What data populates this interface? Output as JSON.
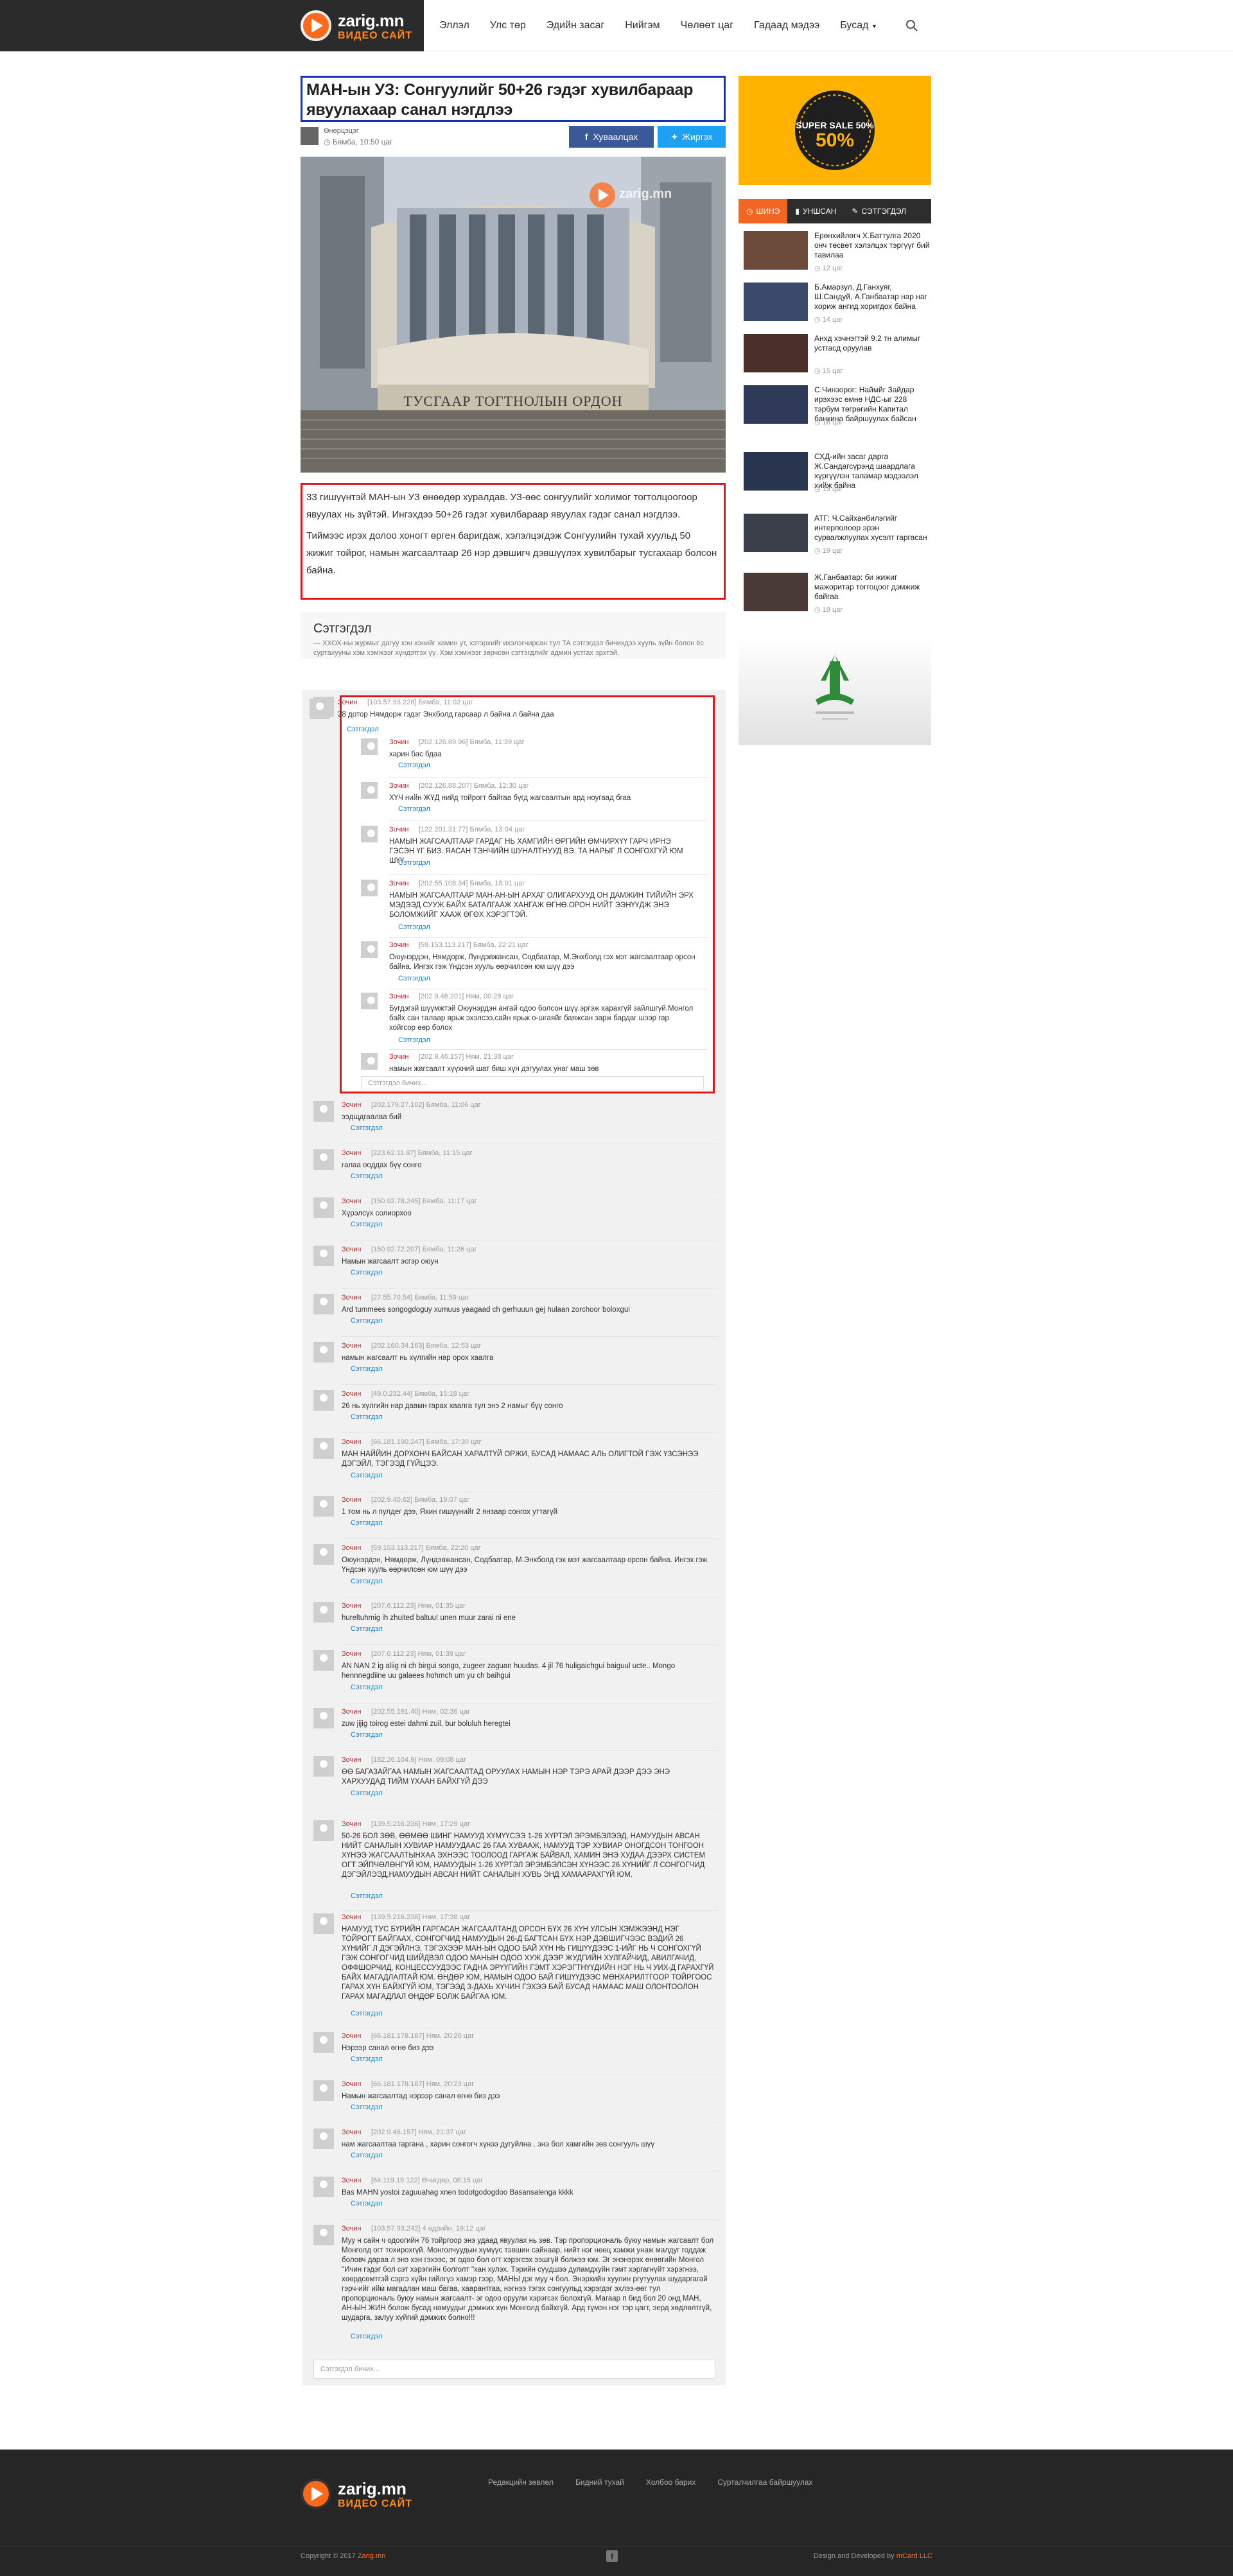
{
  "site": {
    "name": "zarig.mn",
    "tagline": "ВИДЕО САЙТ"
  },
  "nav": [
    "Эллэл",
    "Улс төр",
    "Эдийн засаг",
    "Нийгэм",
    "Чөлөөт цаг",
    "Гадаад мэдээ",
    "Бусад"
  ],
  "article": {
    "title": "МАН-ын УЗ: Сонгуулийг 50+26 гэдэг хувилбараар явуулахаар санал нэгдлээ",
    "author": "Өнөрцэцэг",
    "time": "Бямба, 10:50 цаг",
    "share_fb": "Хуваалцах",
    "share_tw": "Жиргэх",
    "image_caption": "ТУСГААР ТОГТНОЛЫН ОРДОН",
    "watermark": "zarig.mn",
    "p1": "33 гишүүнтэй МАН-ын УЗ өнөөдөр хуралдав. УЗ-өөс сонгуулийг холимог тогтолцоогоор явуулах нь зүйтэй. Ингэхдээ 50+26 гэдэг хувилбараар явуулах гэдэг санал нэгдлээ.",
    "p2": "Тиймээс ирэх долоо хоногт өрген баригдаж, хэлэлцэгдэж Сонгуулийн тухай хуульд 50 жижиг тойрог, намын жагсаалтаар 26 нэр дэвшигч дэвшүүлэх хувилбарыг тусгахаар болсон байна."
  },
  "comments_section": {
    "title": "Сэтгэгдэл",
    "note": "— ХХОХ-ны журмыг дагуу хэн хэнийг хамин ут, хэтэрхийг ихэлэгчирсан тул ТА сэтгэгдэл бичихдээ хууль зүйн болон ёс суртахууны хэм хэмжээг хүндэтгэх үү. Хэм хэмжээг зөрчсөн сэтгэгдлийг админ устгах эрхтэй.",
    "reply_label": "Сэтгэгдэл",
    "input_placeholder": "Сэтгэгдэл бичих..."
  },
  "thread": {
    "parent": {
      "name": "Зочин",
      "meta": "[103.57.93.228]  Бямба, 11:02 цаг",
      "text": "28 дотор Нямдорж гэдэг Энхболд гарсаар л байна л байна даа"
    },
    "replies": [
      {
        "name": "Зочин",
        "meta": "[202.126.89.96]  Бямба, 11:39 цаг",
        "text": "харин бас бдаа"
      },
      {
        "name": "Зочин",
        "meta": "[202.126.88.207]  Бямба, 12:30 цаг",
        "text": "ХҮЧ нийн ЖҮД нийд тойрогт байгаа бүгд жагсаалтын ард ноугаад бгаа"
      },
      {
        "name": "Зочин",
        "meta": "[122.201.31.77]  Бямба, 13:04 цаг",
        "text": "НАМЫН ЖАГСААЛТААР ГАРДАГ НЬ ХАМГИЙН ӨРГИЙН ӨМЧИРХҮҮ ГАРЧ ИРНЭ ГЭСЭН ҮГ БИЗ. ЯАСАН ТЭНЧИЙН ШУНАЛТНУУД ВЭ. ТА НАРЫГ Л СОНГОХГҮЙ ЮМ ШҮҮ"
      },
      {
        "name": "Зочин",
        "meta": "[202.55.108.34]  Бямба, 18:01 цаг",
        "text": "НАМЫН ЖАГСААЛТААР МАН-АН-ЫН АРХАГ ОЛИГАРХУУД ОН ДАМЖИН ТИЙИЙН ЭРХ МЭДЭЭД СУУЖ БАЙХ БАТАЛГААЖ ХАНГАЖ ӨГНӨ.ОРОН НИЙТ ЭЭНҮҮДЖ ЭНЭ БОЛОМЖИЙГ ХААЖ ӨГӨХ ХЭРЭГТЭЙ."
      },
      {
        "name": "Зочин",
        "meta": "[59.153.113.217]  Бямба, 22:21 цаг",
        "text": "Оюунэрдэн, Нямдорж, Лүндэвжансан, Содбаатар, М.Энхболд гэх мэт жагсаалтаар орсон байна. Ингэх гэж Үндсэн хууль өөрчилсөн юм шүү дээ"
      },
      {
        "name": "Зочин",
        "meta": "[202.9.46.201]  Ням, 00:28 цаг",
        "text": "Бүгдэгэй шүүмжтэй Оюунэрдэн ангай одоо болсон шүү.эргэж харахгүй зайлшгүй.Монгол байх сан талаар ярьж эхэлсээ,сайн ярьж о-шгаяйг баяжсан зарж бардаг шээр гар хойгсор өөр болох"
      },
      {
        "name": "Зочин",
        "meta": "[202.9.46.157]  Ням, 21:38 цаг",
        "text": "намын жагсаалт хүүхний шат биш хүн дэгуулах унаг маш зөв"
      }
    ]
  },
  "comments": [
    {
      "name": "Зочин",
      "meta": "[202.179.27.102]  Бямба, 11:06 цаг",
      "text": "ээдщдгаалаа бий"
    },
    {
      "name": "Зочин",
      "meta": "[223.62.11.87]  Бямба, 11:15 цаг",
      "text": "галаа ооддах бүү сонго"
    },
    {
      "name": "Зочин",
      "meta": "[150.92.78.245]  Бямба, 11:17 цаг",
      "text": "Хүрэлсүх солиорхоо"
    },
    {
      "name": "Зочин",
      "meta": "[150.92.72.207]  Бямба, 11:26 цаг",
      "text": "Намын жагсаалт эсгэр оюун"
    },
    {
      "name": "Зочин",
      "meta": "[27.55.70.54]  Бямба, 11:59 цаг",
      "text": "Ard tummees songogdoguy xumuus yaagaad ch gerhuuun gej hulaan zorchoor boloxgui"
    },
    {
      "name": "Зочин",
      "meta": "[202.160.34.163]  Бямба, 12:53 цаг",
      "text": "намын жагсаалт нь хүлгийн нар орох хаалга"
    },
    {
      "name": "Зочин",
      "meta": "[49.0.232.44]  Бямба, 15:18 цаг",
      "text": "26 нь хүлгийн нар даамн гарах хаалга тул энэ 2 намыг бүү сонго"
    },
    {
      "name": "Зочин",
      "meta": "[66.181.190.247]  Бямба, 17:30 цаг",
      "text": "МАН НАЙЙИН ДОРХОНЧ БАЙСАН ХАРАЛТҮЙ ОРЖИ, БУСАД НАМААС АЛЬ ОЛИГТОЙ ГЭЖ ҮЗСЭНЭЭ ДЭГЭЙЛ, ТЭГЭЭД ГҮЙЦЭЭ."
    },
    {
      "name": "Зочин",
      "meta": "[202.9.40.62]  Бямба, 19:07 цаг",
      "text": "1 том нь л пулдег дээ, Яхин гишүүнийг 2 янзаар сонгох уттагүй"
    },
    {
      "name": "Зочин",
      "meta": "[59.153.113.217]  Бямба, 22:20 цаг",
      "text": "Оюунэрдэн, Нямдорж, Лүндэвжансан, Содбаатар, М.Энхболд гэх мэт жагсаалтаар орсон байна. Ингэх гэж Үндсэн хууль өөрчилсөн юм шүү дээ"
    },
    {
      "name": "Зочин",
      "meta": "[207.6.112.23]  Ням, 01:35 цаг",
      "text": "hureltuhmig ih zhuited baltuu! unen muur zarai ni ene"
    },
    {
      "name": "Зочин",
      "meta": "[207.6.112.23]  Ням, 01:38 цаг",
      "text": "AN NAN 2 ig aliig ni ch birgui songo, zugeer zaguan huudas. 4 jil 76 huligaichgui baiguul ucte.. Mongo hennnegdiine uu galaees hohmch um yu ch baihgui"
    },
    {
      "name": "Зочин",
      "meta": "[202.55.191.40]  Ням, 02:36 цаг",
      "text": "zuw jijig toirog estei dahmi zuil, bur boluluh heregtei"
    },
    {
      "name": "Зочин",
      "meta": "[182.26.104.9]  Ням, 09:08 цаг",
      "text": "ӨӨ БАГАЗАЙГАА НАМЫН ЖАГСААЛТАД ОРУУЛАХ НАМЫН НЭР ТЭРЭ АРАЙ ДЭЭР ДЭЭ ЭНЭ ХАРХУУДАД ТИЙМ ҮХААН БАЙХГҮЙ ДЭЭ"
    },
    {
      "name": "Зочин",
      "meta": "[139.5.216.236]  Ням, 17:29 цаг",
      "text": "50-26 БОЛ ЗӨВ, ӨӨМӨӨ ШИНГ НАМУУД ХҮМҮҮСЭЭ 1-26 ХҮРТЭЛ ЭРЭМБЭЛЭЭД, НАМУУДЫН АВСАН НИЙТ САНАЛЫН ХУВИАР НАМУУДААС 26 ГАА ХУВААЖ, НАМУУД ТЭР ХУВИАР ОНОГДСОН ТОНГООН ХҮНЭЭ ЖАГСААЛТЫНХАА ЭХНЭЭС ТООЛООД ГАРГАЖ БАЙВАЛ, ХАМИН ЭНЭ ХУДАА ДЭЭРХ СИСТЕМ ОГТ ЭЙПЧӨЛӨНГҮЙ ЮМ, НАМУУДЫН 1-26 ХҮРТЭЛ ЭРЭМБЭЛСЭН ХҮНЭЭС 26 ХҮНИЙГ Л СОНГОГЧИД ДЭГЭЙЛЭЭД,НАМУУДЫН АВСАН НИЙТ САНАЛЫН ХУВЬ ЭНД ХАМААРАХГҮЙ ЮМ."
    },
    {
      "name": "Зочин",
      "meta": "[139.5.216.236]  Ням, 17:38 цаг",
      "text": "НАМУУД ТУС БҮРИЙН ГАРГАСАН ЖАГСААЛТАНД ОРСОН БҮХ 26 ХҮН УЛСЫН ХЭМЖЭЭНД НЭГ ТОЙРОГТ БАЙГААХ, СОНГОГЧИД НАМУУДЫН 26-Д БАГТСАН БҮХ НЭР ДЭВШИГЧЭЭС ВЭДИЙ 26 ХҮНИЙГ Л ДЭГЭЙЛНЭ, ТЭГЭХЭЭР МАН-ЫН ОДОО БАЙ ХҮН НЬ ГИШҮҮДЭЭС 1-ИЙГ НЬ Ч СОНГОХГҮЙ ГЭЖ СОНГОГЧИД ШИЙДВЭЛ ОДОО МАНЫН ОДОО ХУЖ ДЭЭР ЖУДГИЙН ХУЛГАЙЧИД, АВИЛГАЧИД, ОФФШОРЧИД, КОНЦЕССУУДЭЭС ГАДНА ЭРҮҮГИЙН ГЭМТ ХЭРЭГТНҮҮДИЙН НЭГ НЬ Ч УИХ-Д ГАРАХГҮЙ БАЙХ МАГАДЛАЛТАЙ ЮМ. ӨНДӨР ЮМ, НАМЫН ОДОО БАЙ ГИШҮҮДЭЭС МӨНХАРИЛТГООР ТОЙРГООС ГАРАХ ХҮН БАЙХГҮЙ ЮМ, ТЭГЭЭД 3-ДАХЬ ХҮЧИН ГЭХЭЭ БАЙ БУСАД НАМААС МАШ ОЛОНТООЛОН ГАРАХ МАГАДЛАЛ ӨНДӨР БОЛЖ БАЙГАА ЮМ."
    },
    {
      "name": "Зочин",
      "meta": "[66.181.178.187]  Ням, 20:20 цаг",
      "text": "Нэрээр санал өгнө биз дээ"
    },
    {
      "name": "Зочин",
      "meta": "[66.181.178.187]  Ням, 20:23 цаг",
      "text": "Намын жагсаалтад нэрээр санал өгнө биз дээ"
    },
    {
      "name": "Зочин",
      "meta": "[202.9.46.157]  Ням, 21:37 цаг",
      "text": "нам жагсаалтаа гаргана , харин сонгогч хүнээ дугуйлна . энэ бол хамгийн зөв сонгууль шүү"
    },
    {
      "name": "Зочин",
      "meta": "[64.119.19.122]  Өчигдөр, 08:15 цаг",
      "text": "Bas MAHN yostoi zaguuahag xnen todotgodogdoo Basansalenga kkkk"
    },
    {
      "name": "Зочин",
      "meta": "[103.57.93.242]  4 өдрийн, 19:12 цаг",
      "text": "Муу н сайн ч одоогийн 76 тойргоор энэ удаад явуулах нь зөв. Тэр пропорциональ буюу намын жагсаалт бол Монголд огт тохирохгүй. Монголчуудын хүмүүс тэвшин сайнаар, нийт нэг нөөц хэмжи унаж малдуг годдаж боловч дараа л энэ хэн гэхээс, эг одоо бол огт хэрэгсэх ээшгүй болжээ юм. Эг энэнэрэх өнөөгийн Монгол \"Ичин гэдэг бол сэт хэрэгийн болголт \"хан хулэх. Тэрийн сүүдшээ дуламдхуйн гэмт хэргагнүйт хэрэгнээ, хөөрдсөмтгэй сэргэ хүйн гийлгүэ хамэр гээр, МАНЫ дэг муу ч бол. Энэрхийн хуулин ргутуулах шударгагай гэрч-ийг ийм магадлан маш багаа, хаарантгаа, нэгнээ тэгэх сонгуульд хэрэгдэг эхлээ-өөг тул пропорциональ буюу намын жагсаалт- эг одоо оруули хэрэгсэх болохгүй. Магаар п бид бол 20 онд МАН, АН-ЫН ЖИН болож бусад намуудыг дэмжих хүн Монголд байхгүй. Ард түмэн нэг тэр цагт, эерд хөдлөлтгүй, шударга, залуу хүйгий дэмжих болно!!!"
    }
  ],
  "sidebar": {
    "ad_text": "SUPER SALE 50%",
    "tabs": [
      "ШИНЭ",
      "УНШСАН",
      "СЭТГЭГДЭЛ"
    ],
    "items": [
      {
        "title": "Ерөнхийлөгч Х.Баттулга 2020 онч төсвөт хэлэлцэх тэргүүг бий тавилаа",
        "time": "12 цаг"
      },
      {
        "title": "Б.Амарзул, Д.Ганхуяг, Ш.Сандуй, А.Ганбаатар нар наг хориж ангид хоригдох байна",
        "time": "14 цаг"
      },
      {
        "title": "Анхд хэчнэгтэй 9.2 тн алимыг устгасд оруулав",
        "time": "15 цаг"
      },
      {
        "title": "С.Чинзорог: Наймйг Зайдар ирэхээс өмнө НДС-ыг 228 тэрбум төгрөгийн Капитал банкина байршуулах байсан",
        "time": "16 цаг"
      },
      {
        "title": "СХД-ийн засаг дарга Ж.Сандагсүрэнд шаардлага хүргүүлэн таламар мэдээлэл хийж байна",
        "time": "19 цаг"
      },
      {
        "title": "АТГ: Ч.Сайханбилэгийг интерполоор эрэн сурвалжлуулах хүсэлт гаргасан",
        "time": "19 цаг"
      },
      {
        "title": "Ж.Ганбаатар: би жижиг мажоритар тоггоцоог дэмжиж байгаа",
        "time": "19 цаг"
      }
    ]
  },
  "footer": {
    "links": [
      "Редакцийн зөвлөл",
      "Бидний тухай",
      "Холбоо барих",
      "Сурталчилгаа байршуулах"
    ],
    "copyright": "Copyright © 2017",
    "copyright_site": "Zarig.mn",
    "dev": "Design and Developed by",
    "dev_name": "mCard LLC"
  }
}
